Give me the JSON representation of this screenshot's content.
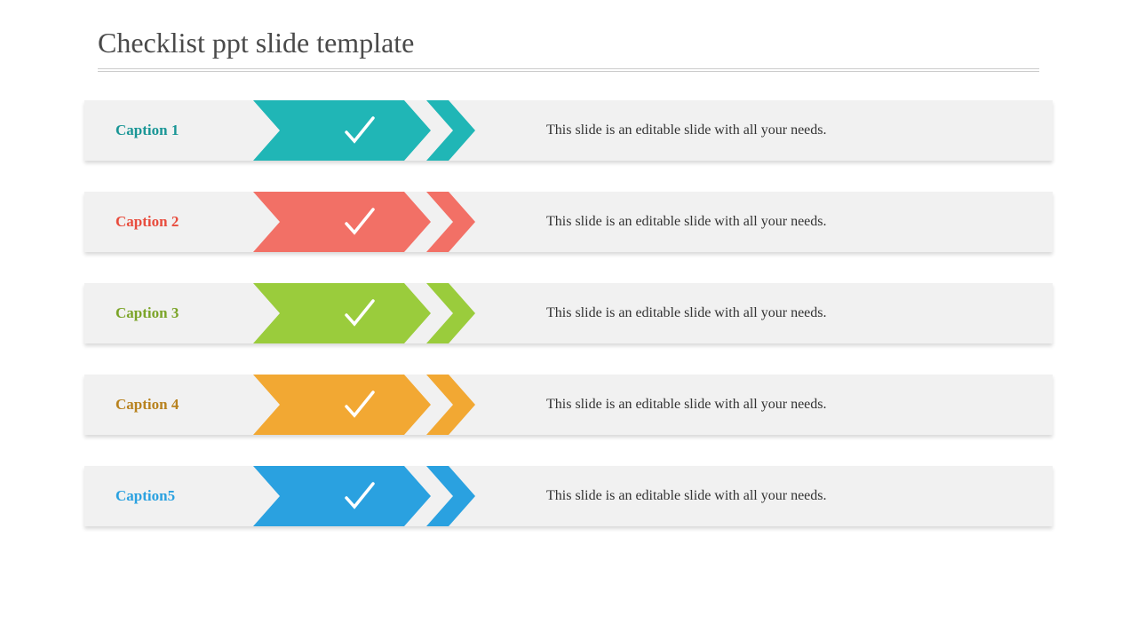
{
  "title": "Checklist ppt slide template",
  "rows": [
    {
      "caption": "Caption 1",
      "desc": "This slide is an editable slide with all your needs.",
      "color": "#20b6b6",
      "captionColor": "#1a9696"
    },
    {
      "caption": "Caption 2",
      "desc": "This slide is an editable slide with all your needs.",
      "color": "#f27066",
      "captionColor": "#e84c3d"
    },
    {
      "caption": "Caption 3",
      "desc": "This slide is an editable slide with all your needs.",
      "color": "#9acc3c",
      "captionColor": "#7ba428"
    },
    {
      "caption": "Caption 4",
      "desc": "This slide is an editable slide with all your needs.",
      "color": "#f2a833",
      "captionColor": "#b8821e"
    },
    {
      "caption": "Caption5",
      "desc": "This slide is an editable slide with all your needs.",
      "color": "#2aa1e0",
      "captionColor": "#2aa1e0"
    }
  ]
}
